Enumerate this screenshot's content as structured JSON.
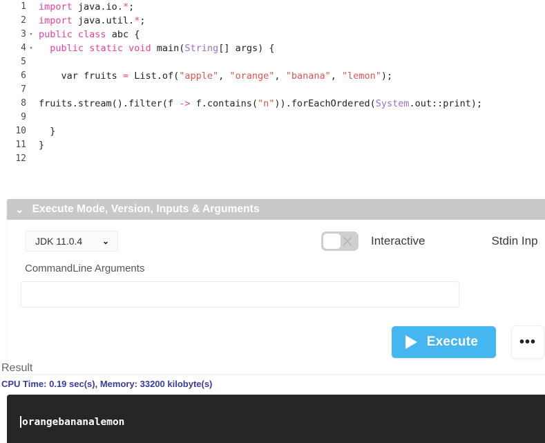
{
  "editor": {
    "total_lines": 12,
    "lines": [
      {
        "num": "1",
        "fold": "",
        "tokens": [
          {
            "t": "import",
            "c": "kw"
          },
          {
            "t": " java.io.",
            "c": "plain"
          },
          {
            "t": "*",
            "c": "kw"
          },
          {
            "t": ";",
            "c": "plain"
          }
        ]
      },
      {
        "num": "2",
        "fold": "",
        "tokens": [
          {
            "t": "import",
            "c": "kw"
          },
          {
            "t": " java.util.",
            "c": "plain"
          },
          {
            "t": "*",
            "c": "kw"
          },
          {
            "t": ";",
            "c": "plain"
          }
        ]
      },
      {
        "num": "3",
        "fold": "▾",
        "tokens": [
          {
            "t": "public",
            "c": "kw"
          },
          {
            "t": " ",
            "c": "plain"
          },
          {
            "t": "class",
            "c": "kw"
          },
          {
            "t": " abc {",
            "c": "plain"
          }
        ]
      },
      {
        "num": "4",
        "fold": "▾",
        "tokens": [
          {
            "t": "  ",
            "c": "plain"
          },
          {
            "t": "public",
            "c": "kw"
          },
          {
            "t": " ",
            "c": "plain"
          },
          {
            "t": "static",
            "c": "kw"
          },
          {
            "t": " ",
            "c": "plain"
          },
          {
            "t": "void",
            "c": "kw"
          },
          {
            "t": " main(",
            "c": "plain"
          },
          {
            "t": "String",
            "c": "type"
          },
          {
            "t": "[] args) {",
            "c": "plain"
          }
        ]
      },
      {
        "num": "5",
        "fold": "",
        "tokens": []
      },
      {
        "num": "6",
        "fold": "",
        "tokens": [
          {
            "t": "    var fruits ",
            "c": "plain"
          },
          {
            "t": "=",
            "c": "op"
          },
          {
            "t": " List.of(",
            "c": "plain"
          },
          {
            "t": "\"apple\"",
            "c": "str"
          },
          {
            "t": ", ",
            "c": "plain"
          },
          {
            "t": "\"orange\"",
            "c": "str"
          },
          {
            "t": ", ",
            "c": "plain"
          },
          {
            "t": "\"banana\"",
            "c": "str"
          },
          {
            "t": ", ",
            "c": "plain"
          },
          {
            "t": "\"lemon\"",
            "c": "str"
          },
          {
            "t": ");",
            "c": "plain"
          }
        ]
      },
      {
        "num": "7",
        "fold": "",
        "tokens": []
      },
      {
        "num": "8",
        "fold": "",
        "tokens": [
          {
            "t": "fruits.stream().filter(f ",
            "c": "plain"
          },
          {
            "t": "->",
            "c": "op"
          },
          {
            "t": " f.contains(",
            "c": "plain"
          },
          {
            "t": "\"n\"",
            "c": "str"
          },
          {
            "t": ")).forEachOrdered(",
            "c": "plain"
          },
          {
            "t": "System",
            "c": "type"
          },
          {
            "t": ".out::print);",
            "c": "plain"
          }
        ]
      },
      {
        "num": "9",
        "fold": "",
        "tokens": []
      },
      {
        "num": "10",
        "fold": "",
        "tokens": [
          {
            "t": "  }",
            "c": "plain"
          }
        ]
      },
      {
        "num": "11",
        "fold": "",
        "tokens": [
          {
            "t": "}",
            "c": "plain"
          }
        ]
      },
      {
        "num": "12",
        "fold": "",
        "tokens": []
      }
    ],
    "colors": {
      "keyword": "#e8409a",
      "string": "#e0544e",
      "type": "#9b6fc4",
      "plain": "#222222",
      "background": "#ffffff"
    }
  },
  "panel": {
    "chevron_icon": "⌄",
    "title": "Execute Mode, Version, Inputs & Arguments",
    "header_background": "#c9c9c9",
    "jdk_select": {
      "value": "JDK 11.0.4",
      "chevron_icon": "⌄"
    },
    "interactive_toggle": {
      "label": "Interactive",
      "state": "off"
    },
    "stdin_label": "Stdin Inp",
    "args": {
      "label": "CommandLine Arguments",
      "value": "",
      "placeholder": ""
    },
    "execute_button": {
      "label": "Execute",
      "icon": "play-icon",
      "color": "#45b6f0"
    },
    "more_button": {
      "label": "•••",
      "icon": "ellipsis-icon"
    }
  },
  "result": {
    "title": "Result",
    "stats": "CPU Time: 0.19 sec(s), Memory: 33200 kilobyte(s)",
    "stats_color": "#3b3b9e",
    "console_output": "orangebananalemon",
    "console_background": "#262626"
  }
}
